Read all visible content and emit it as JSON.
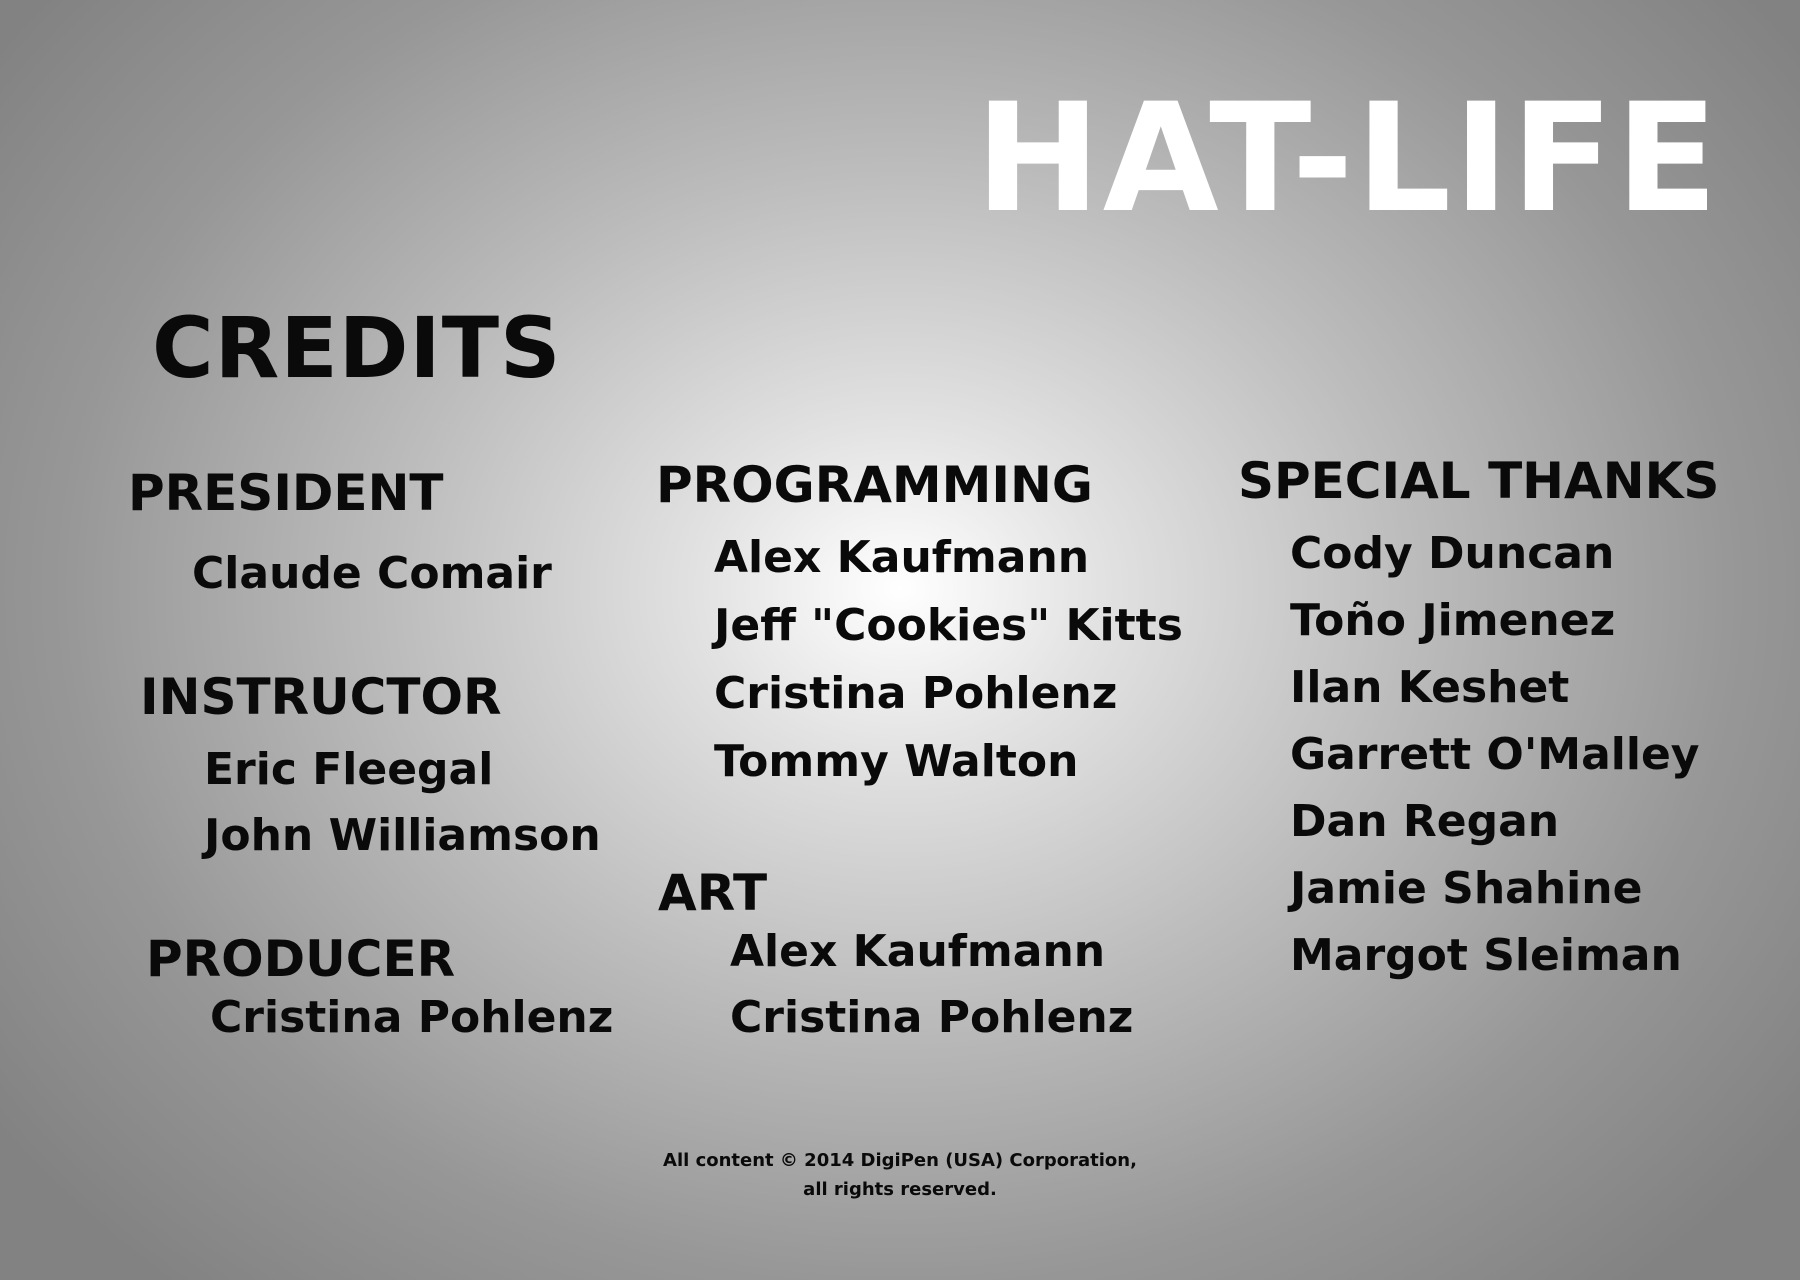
{
  "game_title": "HAT-LIFE",
  "screen_title": "CREDITS",
  "sections": {
    "president": {
      "heading": "PRESIDENT",
      "names": [
        "Claude Comair"
      ]
    },
    "instructor": {
      "heading": "INSTRUCTOR",
      "names": [
        "Eric Fleegal",
        "John Williamson"
      ]
    },
    "producer": {
      "heading": "PRODUCER",
      "names": [
        "Cristina Pohlenz"
      ]
    },
    "programming": {
      "heading": "PROGRAMMING",
      "names": [
        "Alex Kaufmann",
        "Jeff \"Cookies\" Kitts",
        "Cristina Pohlenz",
        "Tommy Walton"
      ]
    },
    "art": {
      "heading": "ART",
      "names": [
        "Alex Kaufmann",
        "Cristina Pohlenz"
      ]
    },
    "special_thanks": {
      "heading": "SPECIAL THANKS",
      "names": [
        "Cody Duncan",
        "Toño Jimenez",
        "Ilan Keshet",
        "Garrett O'Malley",
        "Dan Regan",
        "Jamie Shahine",
        "Margot Sleiman"
      ]
    }
  },
  "copyright": {
    "line1": "All content © 2014 DigiPen (USA) Corporation,",
    "line2": "all rights reserved."
  },
  "colors": {
    "title": "#ffffff",
    "text": "#0a0a0a",
    "background_center": "#ffffff",
    "background_edge": "#828282"
  }
}
